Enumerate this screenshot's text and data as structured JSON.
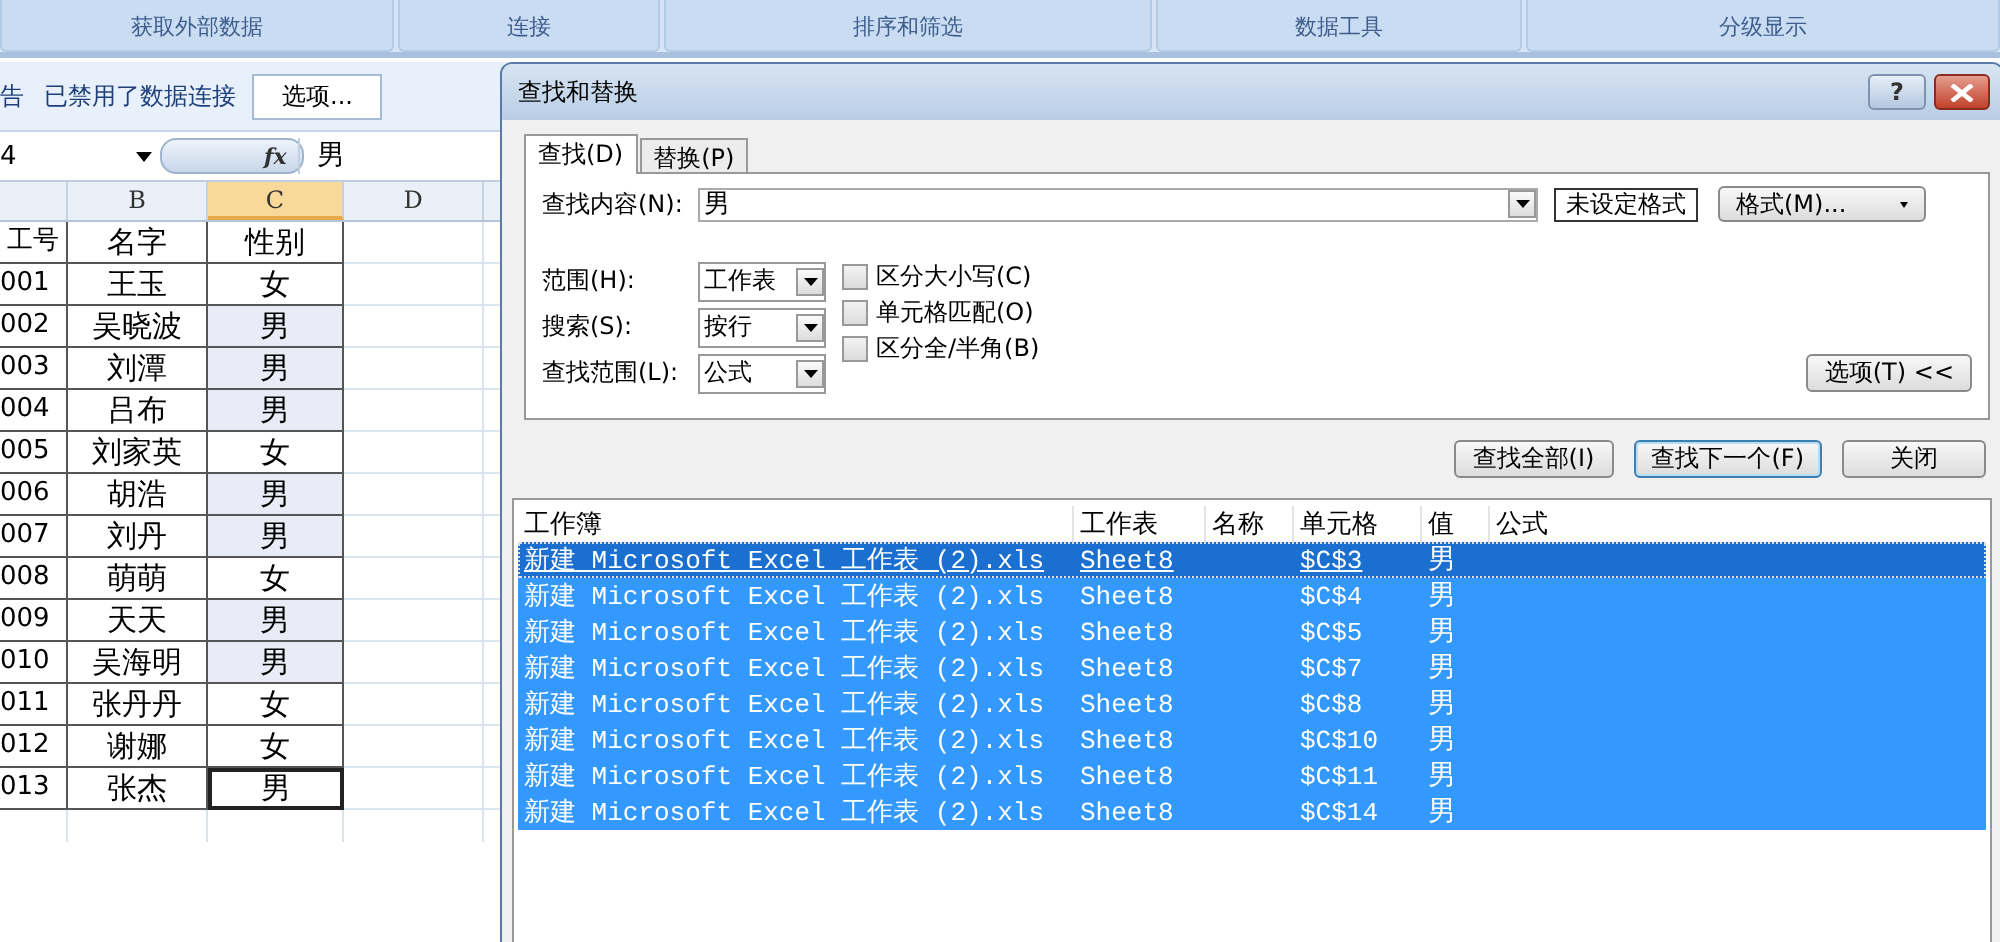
{
  "ribbon_groups": [
    {
      "label": "获取外部数据"
    },
    {
      "label": "连接"
    },
    {
      "label": "排序和筛选"
    },
    {
      "label": "数据工具"
    },
    {
      "label": "分级显示"
    }
  ],
  "message_bar": {
    "prefix": "告",
    "text": "已禁用了数据连接",
    "button": "选项..."
  },
  "formula_bar": {
    "name_box": "4",
    "fx": "fx",
    "value": "男"
  },
  "sheet": {
    "columns": [
      {
        "label": "B",
        "selected": false
      },
      {
        "label": "C",
        "selected": true
      },
      {
        "label": "D",
        "selected": false
      }
    ],
    "header": [
      "工号",
      "名字",
      "性别"
    ],
    "rows": [
      {
        "id": "001",
        "name": "王玉",
        "gender": "女",
        "highlighted": false,
        "active": false
      },
      {
        "id": "002",
        "name": "吴晓波",
        "gender": "男",
        "highlighted": true,
        "active": false
      },
      {
        "id": "003",
        "name": "刘潭",
        "gender": "男",
        "highlighted": true,
        "active": false
      },
      {
        "id": "004",
        "name": "吕布",
        "gender": "男",
        "highlighted": true,
        "active": false
      },
      {
        "id": "005",
        "name": "刘家英",
        "gender": "女",
        "highlighted": false,
        "active": false
      },
      {
        "id": "006",
        "name": "胡浩",
        "gender": "男",
        "highlighted": true,
        "active": false
      },
      {
        "id": "007",
        "name": "刘丹",
        "gender": "男",
        "highlighted": true,
        "active": false
      },
      {
        "id": "008",
        "name": "萌萌",
        "gender": "女",
        "highlighted": false,
        "active": false
      },
      {
        "id": "009",
        "name": "天天",
        "gender": "男",
        "highlighted": true,
        "active": false
      },
      {
        "id": "010",
        "name": "吴海明",
        "gender": "男",
        "highlighted": true,
        "active": false
      },
      {
        "id": "011",
        "name": "张丹丹",
        "gender": "女",
        "highlighted": false,
        "active": false
      },
      {
        "id": "012",
        "name": "谢娜",
        "gender": "女",
        "highlighted": false,
        "active": false
      },
      {
        "id": "013",
        "name": "张杰",
        "gender": "男",
        "highlighted": false,
        "active": true
      }
    ]
  },
  "dialog": {
    "title": "查找和替换",
    "help": "?",
    "tabs": [
      {
        "label": "查找(D)",
        "selected": true
      },
      {
        "label": "替换(P)",
        "selected": false
      }
    ],
    "find_label": "查找内容(N):",
    "find_value": "男",
    "format_status": "未设定格式",
    "format_button": "格式(M)...",
    "selects": [
      {
        "label": "范围(H):",
        "value": "工作表"
      },
      {
        "label": "搜索(S):",
        "value": "按行"
      },
      {
        "label": "查找范围(L):",
        "value": "公式"
      }
    ],
    "checkboxes": [
      {
        "label": "区分大小写(C)",
        "checked": false
      },
      {
        "label": "单元格匹配(O)",
        "checked": false
      },
      {
        "label": "区分全/半角(B)",
        "checked": false
      }
    ],
    "options_button": "选项(T) <<",
    "buttons": [
      {
        "label": "查找全部(I)",
        "default": false
      },
      {
        "label": "查找下一个(F)",
        "default": true
      },
      {
        "label": "关闭",
        "default": false
      }
    ],
    "results": {
      "columns": [
        "工作簿",
        "工作表",
        "名称",
        "单元格",
        "值",
        "公式"
      ],
      "rows": [
        {
          "book": "新建 Microsoft Excel 工作表 (2).xls",
          "sheet": "Sheet8",
          "cell": "$C$3",
          "value": "男",
          "focused": true
        },
        {
          "book": "新建 Microsoft Excel 工作表 (2).xls",
          "sheet": "Sheet8",
          "cell": "$C$4",
          "value": "男",
          "focused": false
        },
        {
          "book": "新建 Microsoft Excel 工作表 (2).xls",
          "sheet": "Sheet8",
          "cell": "$C$5",
          "value": "男",
          "focused": false
        },
        {
          "book": "新建 Microsoft Excel 工作表 (2).xls",
          "sheet": "Sheet8",
          "cell": "$C$7",
          "value": "男",
          "focused": false
        },
        {
          "book": "新建 Microsoft Excel 工作表 (2).xls",
          "sheet": "Sheet8",
          "cell": "$C$8",
          "value": "男",
          "focused": false
        },
        {
          "book": "新建 Microsoft Excel 工作表 (2).xls",
          "sheet": "Sheet8",
          "cell": "$C$10",
          "value": "男",
          "focused": false
        },
        {
          "book": "新建 Microsoft Excel 工作表 (2).xls",
          "sheet": "Sheet8",
          "cell": "$C$11",
          "value": "男",
          "focused": false
        },
        {
          "book": "新建 Microsoft Excel 工作表 (2).xls",
          "sheet": "Sheet8",
          "cell": "$C$14",
          "value": "男",
          "focused": false
        }
      ]
    }
  }
}
